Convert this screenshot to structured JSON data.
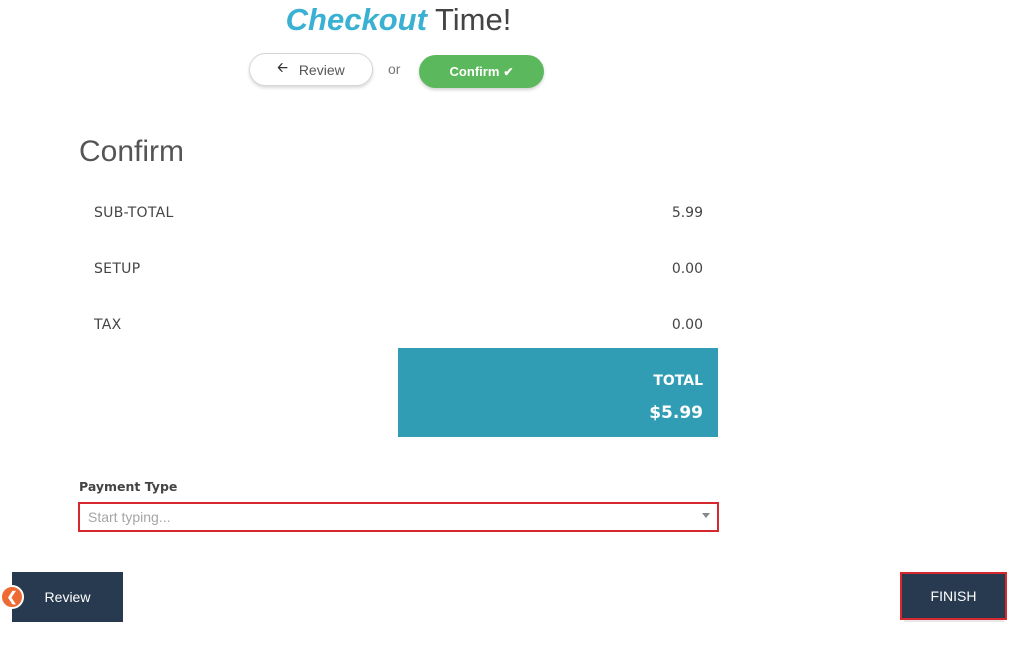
{
  "header": {
    "title_accent": "Checkout",
    "title_rest": " Time!"
  },
  "steps": {
    "review_label": "Review",
    "or_text": "or",
    "confirm_label": "Confirm"
  },
  "section": {
    "heading": "Confirm"
  },
  "summary": {
    "rows": [
      {
        "label": "SUB-TOTAL",
        "value": "5.99"
      },
      {
        "label": "SETUP",
        "value": "0.00"
      },
      {
        "label": "TAX",
        "value": "0.00"
      }
    ],
    "total_label": "TOTAL",
    "total_value": "$5.99"
  },
  "payment": {
    "label": "Payment Type",
    "placeholder": "Start typing..."
  },
  "nav": {
    "review_label": "Review",
    "finish_label": "FINISH"
  },
  "icons": {
    "back_arrow": "arrow-left-icon",
    "check": "check-icon",
    "chevron_left": "chevron-left-icon",
    "caret": "caret-down-icon"
  },
  "colors": {
    "accent_blue": "#3ab0d2",
    "confirm_green": "#5cb85c",
    "total_teal": "#319db5",
    "nav_dark": "#283a50",
    "highlight_red": "#d7282f",
    "badge_orange": "#ee6a33"
  }
}
